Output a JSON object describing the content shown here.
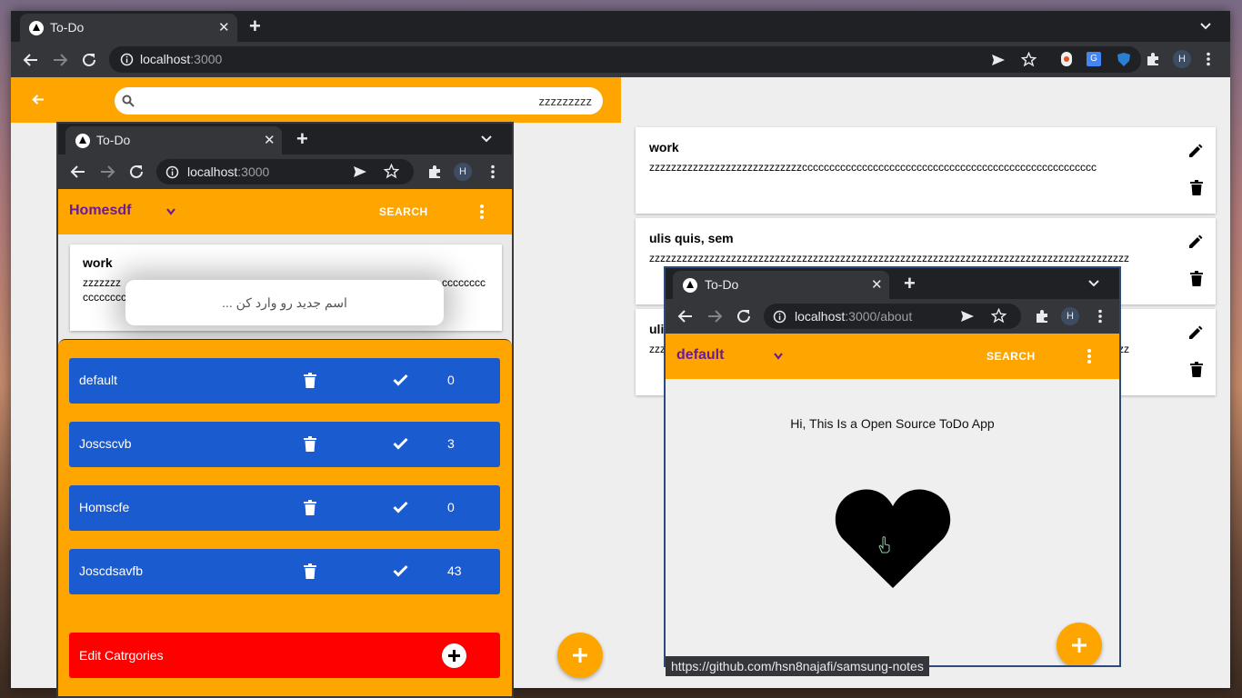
{
  "main_browser": {
    "tab_title": "To-Do",
    "url_host": "localhost",
    "url_rest": ":3000"
  },
  "left_app": {
    "search_value": "zzzzzzzzz"
  },
  "browser2": {
    "tab_title": "To-Do",
    "url_host": "localhost",
    "url_rest": ":3000",
    "category_selected": "Homesdf",
    "search_label": "SEARCH",
    "card": {
      "title": "work",
      "body_left": "zzzzzzz",
      "body_right": "cccccccc",
      "body_line2": "cccccccc"
    },
    "dialog_placeholder": "اسم جدید رو وارد کن ...",
    "categories": [
      {
        "name": "default",
        "count": "0"
      },
      {
        "name": "Joscscvb",
        "count": "3"
      },
      {
        "name": "Homscfe",
        "count": "0"
      },
      {
        "name": "Joscdsavfb",
        "count": "43"
      }
    ],
    "edit_categories_label": "Edit Catrgories"
  },
  "notes": [
    {
      "title": "work",
      "body": "zzzzzzzzzzzzzzzzzzzzzzzzzzzzcccccccccccccccccccccccccccccccccccccccccccccccccccccc"
    },
    {
      "title": "ulis quis, sem",
      "body": "zzzzzzzzzzzzzzzzzzzzzzzzzzzzzzzzzzzzzzzzzzzzzzzzzzzzzzzzzzzzzzzzzzzzzzzzzzzzzzzzzzzzzzzz"
    },
    {
      "title": "ulis",
      "body": "zzzzzzzzzzzzzzzzzzzzzzzzzzzzzzzzzzzzzzzzzzzzzzzzzzzzzzzzzzzzzzzzzzzzzzzzzzzzzzzzzzzzzzzz"
    }
  ],
  "browser3": {
    "tab_title": "To-Do",
    "url_host": "localhost",
    "url_rest": ":3000/about",
    "category_selected": "default",
    "search_label": "SEARCH",
    "about_text": "Hi, This Is a Open Source ToDo App",
    "status_url": "https://github.com/hsn8najafi/samsung-notes"
  },
  "colors": {
    "accent_orange": "#ffa500",
    "category_blue": "#1a5cd0",
    "edit_red": "#ff0000",
    "category_text_purple": "#6a1b9a"
  },
  "icons": [
    "back-arrow-icon",
    "search-icon",
    "trash-icon",
    "check-icon",
    "plus-icon",
    "pencil-icon",
    "heart-icon",
    "menu-dots-icon",
    "chevron-down-icon",
    "reload-icon",
    "star-icon",
    "send-icon",
    "extensions-icon",
    "info-icon",
    "hand-cursor-icon"
  ]
}
